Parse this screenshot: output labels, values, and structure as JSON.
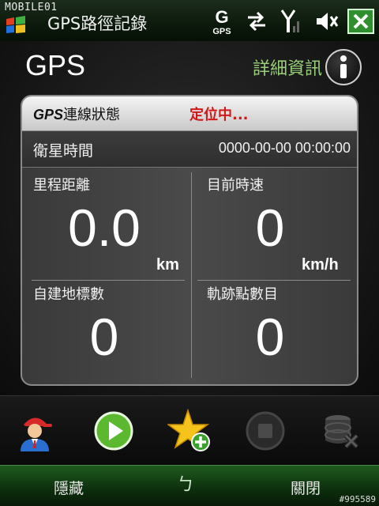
{
  "watermark_top": "MOBILE01",
  "window": {
    "title": "GPS路徑記錄"
  },
  "status_icons": [
    "gps-icon",
    "data-sync-icon",
    "signal-icon",
    "volume-icon",
    "close-icon"
  ],
  "status_gps_text": "GPS",
  "header": {
    "title": "GPS",
    "details_label": "詳細資訊"
  },
  "panel": {
    "connection_label_prefix": "GPS",
    "connection_label_suffix": "連線狀態",
    "connection_status": "定位中...",
    "satellite_time_label": "衛星時間",
    "satellite_time_value": "0000-00-00 00:00:00",
    "cells": [
      {
        "label": "里程距離",
        "value": "0.0",
        "unit": "km"
      },
      {
        "label": "目前時速",
        "value": "0",
        "unit": "km/h"
      },
      {
        "label": "自建地標數",
        "value": "0",
        "unit": ""
      },
      {
        "label": "軌跡點數目",
        "value": "0",
        "unit": ""
      }
    ]
  },
  "toolbar": [
    "person-icon",
    "play-icon",
    "add-landmark-icon",
    "stop-icon",
    "delete-database-icon"
  ],
  "softkeys": {
    "left": "隱藏",
    "right": "關閉",
    "sip": "ㄅ"
  },
  "watermark_bottom": "#995589",
  "colors": {
    "status_red": "#d01818",
    "accent_green": "#9bd07a"
  }
}
